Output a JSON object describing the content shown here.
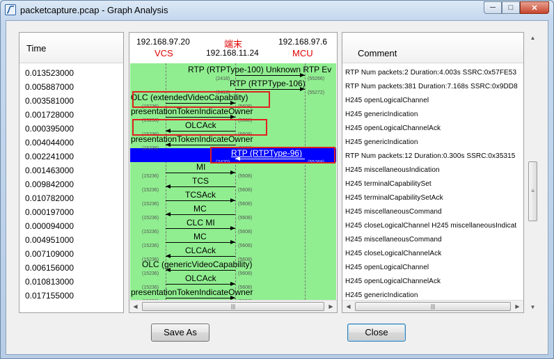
{
  "window": {
    "title": "packetcapture.pcap - Graph Analysis",
    "minimize_label": "─",
    "maximize_label": "□",
    "close_label": "✕"
  },
  "time_column": {
    "header": "Time",
    "rows": [
      "0.013523000",
      "0.005887000",
      "0.003581000",
      "0.001728000",
      "0.000395000",
      "0.004044000",
      "0.002241000",
      "0.001463000",
      "0.009842000",
      "0.010782000",
      "0.000197000",
      "0.000094000",
      "0.004951000",
      "0.007109000",
      "0.006156000",
      "0.010813000",
      "0.017155000"
    ]
  },
  "graph": {
    "nodes": [
      {
        "ip": "192.168.97.20",
        "name": "VCS"
      },
      {
        "ip": "192.168.11.24",
        "name": "端末"
      },
      {
        "ip": "192.168.97.6",
        "name": "MCU"
      }
    ],
    "selected_row": 6,
    "arrows": [
      {
        "label": "RTP (RTPType-100) Unknown RTP Ev",
        "from": 1,
        "to": 2,
        "src_port": "(2418)",
        "dst_port": "(55266)",
        "highlight": false
      },
      {
        "label": "RTP (RTPType-106)",
        "from": 1,
        "to": 2,
        "src_port": "(2416)",
        "dst_port": "(55272)",
        "highlight": false
      },
      {
        "label": "OLC (extendedVideoCapability)",
        "from": 0,
        "to": 1,
        "src_port": "(15236)",
        "dst_port": "(5608)",
        "highlight": true
      },
      {
        "label": "presentationTokenIndicateOwner",
        "from": 0,
        "to": 1,
        "src_port": "(15236)",
        "dst_port": "(5608)",
        "highlight": false
      },
      {
        "label": "OLCAck",
        "from": 1,
        "to": 0,
        "src_port": "(15236)",
        "dst_port": "(5608)",
        "highlight": true
      },
      {
        "label": "presentationTokenIndicateOwner",
        "from": 1,
        "to": 0,
        "src_port": "(15236)",
        "dst_port": "(5608)",
        "highlight": false
      },
      {
        "label": "RTP (RTPType-96)",
        "from": 2,
        "to": 1,
        "src_port": "(2420)",
        "dst_port": "(55268)",
        "highlight": true
      },
      {
        "label": "MI",
        "from": 0,
        "to": 1,
        "src_port": "(15236)",
        "dst_port": "(5608)",
        "highlight": false
      },
      {
        "label": "TCS",
        "from": 1,
        "to": 0,
        "src_port": "(15236)",
        "dst_port": "(5608)",
        "highlight": false
      },
      {
        "label": "TCSAck",
        "from": 0,
        "to": 1,
        "src_port": "(15236)",
        "dst_port": "(5608)",
        "highlight": false
      },
      {
        "label": "MC",
        "from": 1,
        "to": 0,
        "src_port": "(15236)",
        "dst_port": "(5608)",
        "highlight": false
      },
      {
        "label": "CLC MI",
        "from": 0,
        "to": 1,
        "src_port": "(15236)",
        "dst_port": "(5608)",
        "highlight": false
      },
      {
        "label": "MC",
        "from": 0,
        "to": 1,
        "src_port": "(15236)",
        "dst_port": "(5608)",
        "highlight": false
      },
      {
        "label": "CLCAck",
        "from": 1,
        "to": 0,
        "src_port": "(15236)",
        "dst_port": "(5608)",
        "highlight": false
      },
      {
        "label": "OLC (genericVideoCapability)",
        "from": 1,
        "to": 0,
        "src_port": "(15236)",
        "dst_port": "(5608)",
        "highlight": false
      },
      {
        "label": "OLCAck",
        "from": 0,
        "to": 1,
        "src_port": "(15236)",
        "dst_port": "(5608)",
        "highlight": false
      },
      {
        "label": "presentationTokenIndicateOwner",
        "from": 0,
        "to": 1,
        "src_port": "(15236)",
        "dst_port": "(5608)",
        "highlight": false
      }
    ]
  },
  "comment_column": {
    "header": "Comment",
    "rows": [
      "RTP Num packets:2  Duration:4.003s SSRC:0x57FE53",
      "RTP Num packets:381  Duration:7.168s SSRC:0x9DD8",
      "H245 openLogicalChannel",
      "H245 genericIndication",
      "H245 openLogicalChannelAck",
      "H245 genericIndication",
      "RTP Num packets:12  Duration:0.300s SSRC:0x35315",
      "H245 miscellaneousIndication",
      "H245 terminalCapabilitySet",
      "H245 terminalCapabilitySetAck",
      "H245 miscellaneousCommand",
      "H245 closeLogicalChannel H245 miscellaneousIndicat",
      "H245 miscellaneousCommand",
      "H245 closeLogicalChannelAck",
      "H245 openLogicalChannel",
      "H245 openLogicalChannelAck",
      "H245 genericIndication"
    ]
  },
  "buttons": {
    "save_as": "Save As",
    "close": "Close"
  },
  "scroll": {
    "left_arrow": "◀",
    "right_arrow": "▶",
    "up_arrow": "▲",
    "down_arrow": "▼",
    "grip": "|||",
    "vgrip": "≡"
  }
}
